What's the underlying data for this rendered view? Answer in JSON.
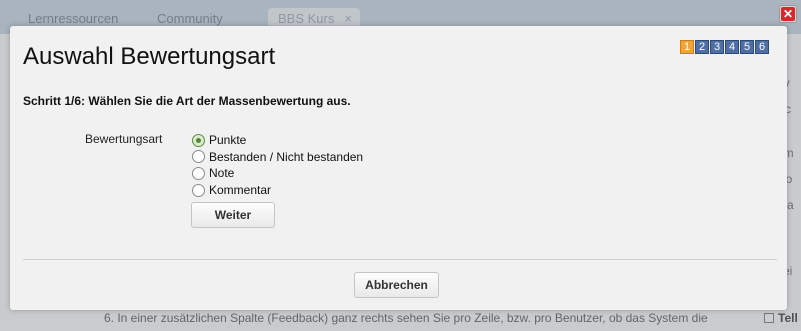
{
  "background": {
    "tabs": [
      "Lernressourcen",
      "Community",
      "BBS Kurs"
    ],
    "tab_close": "×",
    "right_fragments": [
      "ev",
      "Sc",
      "am",
      "No",
      "Ma",
      "st",
      "Tei"
    ],
    "footer_text": "6. In einer zusätzlichen Spalte (Feedback) ganz rechts sehen Sie pro Zeile, bzw. pro Benutzer, ob das System die",
    "footer_right": "Tell"
  },
  "dialog": {
    "title": "Auswahl Bewertungsart",
    "steps": [
      "1",
      "2",
      "3",
      "4",
      "5",
      "6"
    ],
    "current_step": 1,
    "instruction": "Schritt 1/6: Wählen Sie die Art der Massenbewertung aus.",
    "field_label": "Bewertungsart",
    "options": [
      {
        "label": "Punkte",
        "checked": true
      },
      {
        "label": "Bestanden / Nicht bestanden",
        "checked": false
      },
      {
        "label": "Note",
        "checked": false
      },
      {
        "label": "Kommentar",
        "checked": false
      }
    ],
    "next_label": "Weiter",
    "cancel_label": "Abbrechen",
    "close_glyph": "✕"
  },
  "colors": {
    "step_active": "#f0a43a",
    "step_inactive": "#4d6fa3",
    "close_red": "#d9272e",
    "radio_checked": "#4f8a32"
  }
}
